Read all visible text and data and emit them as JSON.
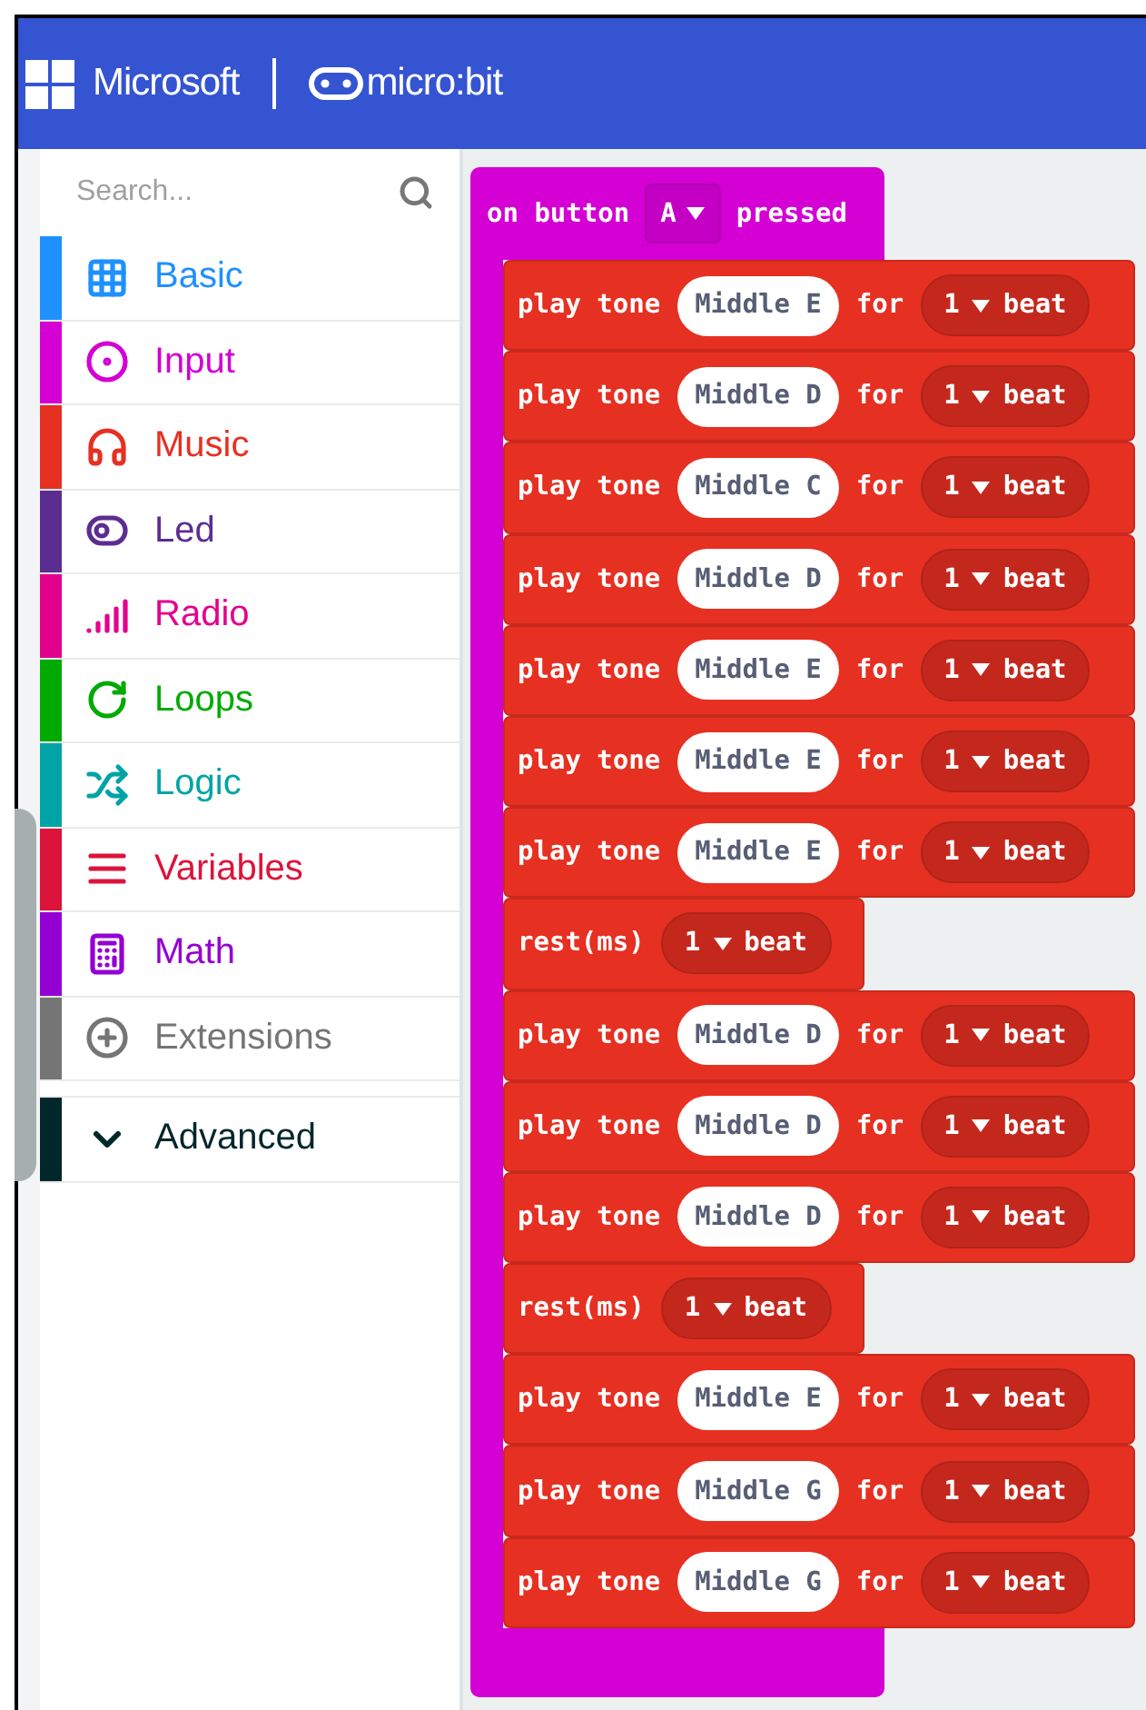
{
  "header": {
    "brand": "Microsoft",
    "product": "micro:bit"
  },
  "search": {
    "placeholder": "Search..."
  },
  "categories": [
    {
      "label": "Basic",
      "color": "#1e90ff"
    },
    {
      "label": "Input",
      "color": "#d400d4"
    },
    {
      "label": "Music",
      "color": "#e63022"
    },
    {
      "label": "Led",
      "color": "#5c2d91"
    },
    {
      "label": "Radio",
      "color": "#e3008c"
    },
    {
      "label": "Loops",
      "color": "#00aa00"
    },
    {
      "label": "Logic",
      "color": "#00a4a6"
    },
    {
      "label": "Variables",
      "color": "#dc143c"
    },
    {
      "label": "Math",
      "color": "#9400d3"
    },
    {
      "label": "Extensions",
      "color": "#757575"
    }
  ],
  "advanced": {
    "label": "Advanced",
    "expanded": false
  },
  "event_block": {
    "prefix": "on button",
    "button": "A",
    "suffix": "pressed"
  },
  "statements": [
    {
      "kind": "play_tone",
      "label": "play tone",
      "note": "Middle E",
      "connector": "for",
      "beats": "1",
      "unit": "beat"
    },
    {
      "kind": "play_tone",
      "label": "play tone",
      "note": "Middle D",
      "connector": "for",
      "beats": "1",
      "unit": "beat"
    },
    {
      "kind": "play_tone",
      "label": "play tone",
      "note": "Middle C",
      "connector": "for",
      "beats": "1",
      "unit": "beat"
    },
    {
      "kind": "play_tone",
      "label": "play tone",
      "note": "Middle D",
      "connector": "for",
      "beats": "1",
      "unit": "beat"
    },
    {
      "kind": "play_tone",
      "label": "play tone",
      "note": "Middle E",
      "connector": "for",
      "beats": "1",
      "unit": "beat"
    },
    {
      "kind": "play_tone",
      "label": "play tone",
      "note": "Middle E",
      "connector": "for",
      "beats": "1",
      "unit": "beat"
    },
    {
      "kind": "play_tone",
      "label": "play tone",
      "note": "Middle E",
      "connector": "for",
      "beats": "1",
      "unit": "beat"
    },
    {
      "kind": "rest",
      "label": "rest(ms)",
      "beats": "1",
      "unit": "beat"
    },
    {
      "kind": "play_tone",
      "label": "play tone",
      "note": "Middle D",
      "connector": "for",
      "beats": "1",
      "unit": "beat"
    },
    {
      "kind": "play_tone",
      "label": "play tone",
      "note": "Middle D",
      "connector": "for",
      "beats": "1",
      "unit": "beat"
    },
    {
      "kind": "play_tone",
      "label": "play tone",
      "note": "Middle D",
      "connector": "for",
      "beats": "1",
      "unit": "beat"
    },
    {
      "kind": "rest",
      "label": "rest(ms)",
      "beats": "1",
      "unit": "beat"
    },
    {
      "kind": "play_tone",
      "label": "play tone",
      "note": "Middle E",
      "connector": "for",
      "beats": "1",
      "unit": "beat"
    },
    {
      "kind": "play_tone",
      "label": "play tone",
      "note": "Middle G",
      "connector": "for",
      "beats": "1",
      "unit": "beat"
    },
    {
      "kind": "play_tone",
      "label": "play tone",
      "note": "Middle G",
      "connector": "for",
      "beats": "1",
      "unit": "beat"
    }
  ]
}
